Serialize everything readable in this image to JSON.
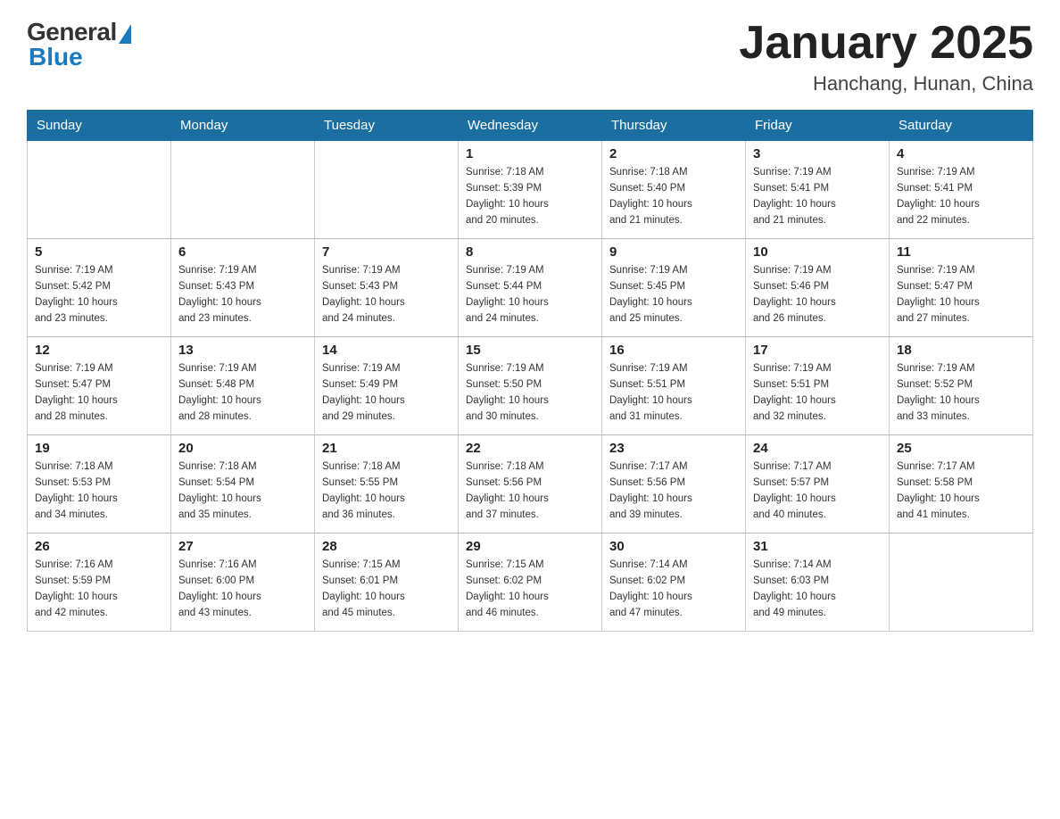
{
  "header": {
    "logo_general": "General",
    "logo_blue": "Blue",
    "month_title": "January 2025",
    "location": "Hanchang, Hunan, China"
  },
  "days_of_week": [
    "Sunday",
    "Monday",
    "Tuesday",
    "Wednesday",
    "Thursday",
    "Friday",
    "Saturday"
  ],
  "weeks": [
    [
      {
        "day": "",
        "info": ""
      },
      {
        "day": "",
        "info": ""
      },
      {
        "day": "",
        "info": ""
      },
      {
        "day": "1",
        "info": "Sunrise: 7:18 AM\nSunset: 5:39 PM\nDaylight: 10 hours\nand 20 minutes."
      },
      {
        "day": "2",
        "info": "Sunrise: 7:18 AM\nSunset: 5:40 PM\nDaylight: 10 hours\nand 21 minutes."
      },
      {
        "day": "3",
        "info": "Sunrise: 7:19 AM\nSunset: 5:41 PM\nDaylight: 10 hours\nand 21 minutes."
      },
      {
        "day": "4",
        "info": "Sunrise: 7:19 AM\nSunset: 5:41 PM\nDaylight: 10 hours\nand 22 minutes."
      }
    ],
    [
      {
        "day": "5",
        "info": "Sunrise: 7:19 AM\nSunset: 5:42 PM\nDaylight: 10 hours\nand 23 minutes."
      },
      {
        "day": "6",
        "info": "Sunrise: 7:19 AM\nSunset: 5:43 PM\nDaylight: 10 hours\nand 23 minutes."
      },
      {
        "day": "7",
        "info": "Sunrise: 7:19 AM\nSunset: 5:43 PM\nDaylight: 10 hours\nand 24 minutes."
      },
      {
        "day": "8",
        "info": "Sunrise: 7:19 AM\nSunset: 5:44 PM\nDaylight: 10 hours\nand 24 minutes."
      },
      {
        "day": "9",
        "info": "Sunrise: 7:19 AM\nSunset: 5:45 PM\nDaylight: 10 hours\nand 25 minutes."
      },
      {
        "day": "10",
        "info": "Sunrise: 7:19 AM\nSunset: 5:46 PM\nDaylight: 10 hours\nand 26 minutes."
      },
      {
        "day": "11",
        "info": "Sunrise: 7:19 AM\nSunset: 5:47 PM\nDaylight: 10 hours\nand 27 minutes."
      }
    ],
    [
      {
        "day": "12",
        "info": "Sunrise: 7:19 AM\nSunset: 5:47 PM\nDaylight: 10 hours\nand 28 minutes."
      },
      {
        "day": "13",
        "info": "Sunrise: 7:19 AM\nSunset: 5:48 PM\nDaylight: 10 hours\nand 28 minutes."
      },
      {
        "day": "14",
        "info": "Sunrise: 7:19 AM\nSunset: 5:49 PM\nDaylight: 10 hours\nand 29 minutes."
      },
      {
        "day": "15",
        "info": "Sunrise: 7:19 AM\nSunset: 5:50 PM\nDaylight: 10 hours\nand 30 minutes."
      },
      {
        "day": "16",
        "info": "Sunrise: 7:19 AM\nSunset: 5:51 PM\nDaylight: 10 hours\nand 31 minutes."
      },
      {
        "day": "17",
        "info": "Sunrise: 7:19 AM\nSunset: 5:51 PM\nDaylight: 10 hours\nand 32 minutes."
      },
      {
        "day": "18",
        "info": "Sunrise: 7:19 AM\nSunset: 5:52 PM\nDaylight: 10 hours\nand 33 minutes."
      }
    ],
    [
      {
        "day": "19",
        "info": "Sunrise: 7:18 AM\nSunset: 5:53 PM\nDaylight: 10 hours\nand 34 minutes."
      },
      {
        "day": "20",
        "info": "Sunrise: 7:18 AM\nSunset: 5:54 PM\nDaylight: 10 hours\nand 35 minutes."
      },
      {
        "day": "21",
        "info": "Sunrise: 7:18 AM\nSunset: 5:55 PM\nDaylight: 10 hours\nand 36 minutes."
      },
      {
        "day": "22",
        "info": "Sunrise: 7:18 AM\nSunset: 5:56 PM\nDaylight: 10 hours\nand 37 minutes."
      },
      {
        "day": "23",
        "info": "Sunrise: 7:17 AM\nSunset: 5:56 PM\nDaylight: 10 hours\nand 39 minutes."
      },
      {
        "day": "24",
        "info": "Sunrise: 7:17 AM\nSunset: 5:57 PM\nDaylight: 10 hours\nand 40 minutes."
      },
      {
        "day": "25",
        "info": "Sunrise: 7:17 AM\nSunset: 5:58 PM\nDaylight: 10 hours\nand 41 minutes."
      }
    ],
    [
      {
        "day": "26",
        "info": "Sunrise: 7:16 AM\nSunset: 5:59 PM\nDaylight: 10 hours\nand 42 minutes."
      },
      {
        "day": "27",
        "info": "Sunrise: 7:16 AM\nSunset: 6:00 PM\nDaylight: 10 hours\nand 43 minutes."
      },
      {
        "day": "28",
        "info": "Sunrise: 7:15 AM\nSunset: 6:01 PM\nDaylight: 10 hours\nand 45 minutes."
      },
      {
        "day": "29",
        "info": "Sunrise: 7:15 AM\nSunset: 6:02 PM\nDaylight: 10 hours\nand 46 minutes."
      },
      {
        "day": "30",
        "info": "Sunrise: 7:14 AM\nSunset: 6:02 PM\nDaylight: 10 hours\nand 47 minutes."
      },
      {
        "day": "31",
        "info": "Sunrise: 7:14 AM\nSunset: 6:03 PM\nDaylight: 10 hours\nand 49 minutes."
      },
      {
        "day": "",
        "info": ""
      }
    ]
  ]
}
